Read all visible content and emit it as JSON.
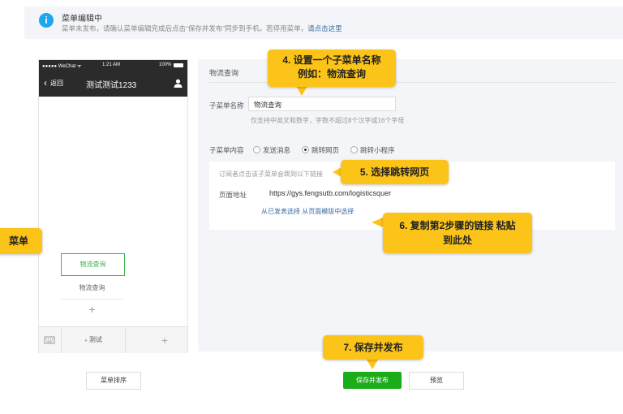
{
  "notice": {
    "title": "菜单编辑中",
    "text": "菜单未发布，请确认菜单编辑完成后点击“保存并发布”同步到手机。若停用菜单，",
    "link": "请点击这里"
  },
  "phone": {
    "carrier": "●●●●● WeChat ᯤ",
    "time": "1:21 AM",
    "battery": "100%",
    "back_label": "返回",
    "title": "测试测试1233",
    "submenu_active": "物流查询",
    "submenu_item": "物流查询",
    "main_menu": "测试",
    "plus": "+"
  },
  "editor": {
    "panel_title": "物流查询",
    "name_label": "子菜单名称",
    "name_value": "物流查询",
    "name_hint": "仅支持中英文和数字，字数不超过8个汉字或16个字母",
    "content_label": "子菜单内容",
    "radio_options": [
      "发送消息",
      "跳转网页",
      "跳转小程序"
    ],
    "selected_option": "跳转网页",
    "inner_hint": "订阅者点击该子菜单会跳到以下链接",
    "url_label": "页面地址",
    "url_value": "https://gys.fengsutb.com/logisticsquer",
    "url_links": "从已发表选择   从页面模版中选择"
  },
  "buttons": {
    "sort": "菜单排序",
    "save": "保存并发布",
    "preview": "预览"
  },
  "callouts": {
    "step4_line1": "4. 设置一个子菜单名称",
    "step4_line2": "例如：物流查询",
    "step5": "5. 选择跳转网页",
    "step6_line1": "6. 复制第2步骤的链接 粘贴",
    "step6_line2": "到此处",
    "step7": "7. 保存并发布",
    "left_partial": "菜单"
  },
  "colors": {
    "callout": "#fcc418",
    "save_green": "#1aad19",
    "info_blue": "#1aa6f0",
    "phone_header": "#2b2b2b",
    "active_green": "#39b54a"
  }
}
